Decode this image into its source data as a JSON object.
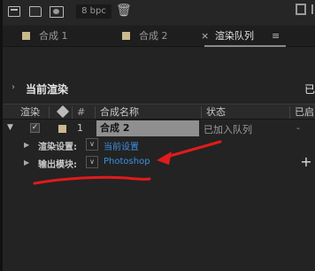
{
  "toolbar": {
    "bpc_label": "8 bpc",
    "icons": [
      "layers-icon",
      "folder-icon",
      "composition-icon",
      "trash-icon"
    ]
  },
  "tabs": [
    {
      "label": "合成 1",
      "color": "#c9b98d"
    },
    {
      "label": "合成 2",
      "color": "#c9b98d"
    },
    {
      "label": "渲染队列",
      "close": "×",
      "menu": "≡"
    }
  ],
  "current_render": {
    "chevron": "›",
    "title": "当前渲染",
    "right_text": "已"
  },
  "columns": {
    "render": "渲染",
    "num": "#",
    "name": "合成名称",
    "status": "状态",
    "started": "已启"
  },
  "queue_row": {
    "expand": "▼",
    "check": "✓",
    "num": "1",
    "name": "合成 2",
    "status": "已加入队列",
    "started": "-",
    "swatch": "#c9b98d"
  },
  "render_settings": {
    "label": "渲染设置:",
    "dropdown": "∨",
    "value": "当前设置"
  },
  "output_module": {
    "label": "输出模块:",
    "dropdown": "∨",
    "value": "Photoshop",
    "add": "+"
  },
  "colors": {
    "link": "#3d8fe0",
    "annotation": "#e11b1b",
    "selected_row": "#8f8f8f"
  }
}
